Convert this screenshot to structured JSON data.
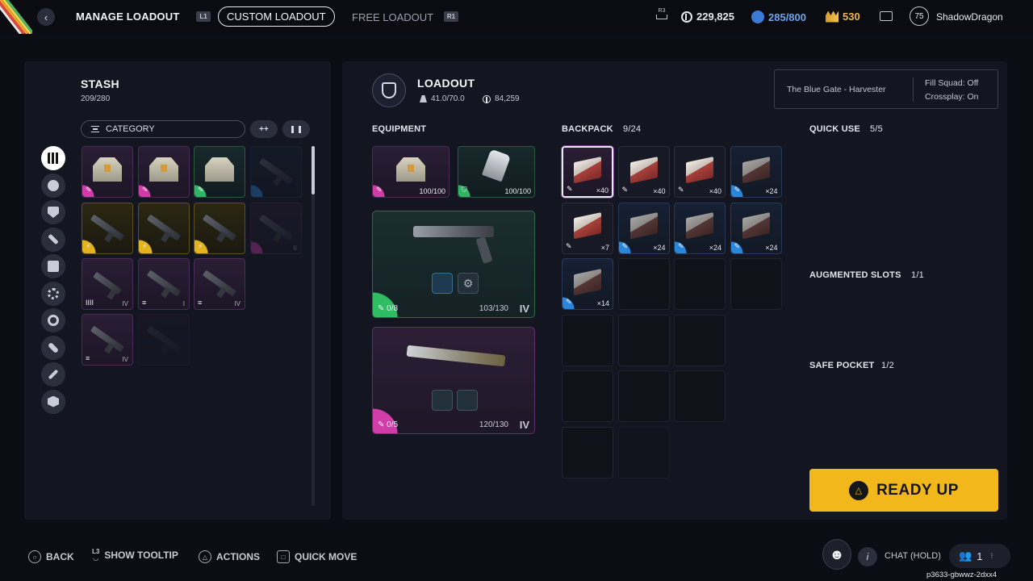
{
  "topbar": {
    "title": "MANAGE LOADOUT",
    "left_shoulder": "L1",
    "right_shoulder": "R1",
    "tabs": [
      {
        "label": "CUSTOM LOADOUT",
        "active": true
      },
      {
        "label": "FREE LOADOUT",
        "active": false
      }
    ],
    "r3_label": "R3",
    "coins": "229,825",
    "blue_currency": "285/800",
    "gold_currency": "530",
    "player_level": "75",
    "player_name": "ShadowDragon"
  },
  "stash": {
    "title": "STASH",
    "capacity": "209/280",
    "category_label": "CATEGORY",
    "expand_glyph": "++",
    "rows": [
      [
        {
          "rarity": "purple",
          "kind": "vest",
          "tag": "",
          "faded": false
        },
        {
          "rarity": "purple",
          "kind": "vest",
          "tag": "",
          "faded": false
        },
        {
          "rarity": "green",
          "kind": "vest",
          "tag": "",
          "faded": false
        },
        {
          "rarity": "blue",
          "kind": "gun",
          "tag": "",
          "faded": true
        }
      ],
      [
        {
          "rarity": "yellow",
          "kind": "gun",
          "tag": "",
          "faded": false
        },
        {
          "rarity": "yellow",
          "kind": "gun",
          "tag": "",
          "faded": false
        },
        {
          "rarity": "yellow",
          "kind": "gun",
          "tag": "",
          "faded": false
        },
        {
          "rarity": "purple",
          "kind": "gun",
          "tag": "II",
          "faded": true
        }
      ],
      [
        {
          "rarity": "purple",
          "kind": "gun",
          "tag": "IV",
          "faded": false
        },
        {
          "rarity": "purple",
          "kind": "gun",
          "tag": "I",
          "faded": false
        },
        {
          "rarity": "purple",
          "kind": "gun",
          "tag": "IV",
          "faded": false
        }
      ],
      [
        {
          "rarity": "purple",
          "kind": "gun",
          "tag": "IV",
          "faded": false
        },
        {
          "rarity": "purple",
          "kind": "gun",
          "tag": "",
          "faded": true
        }
      ]
    ],
    "category_icons": [
      "grid-icon",
      "ammo-icon",
      "shield-icon",
      "gun-icon",
      "book-icon",
      "gear-icon",
      "ring-icon",
      "bandage-icon",
      "wrench-icon",
      "cube-icon"
    ]
  },
  "loadout": {
    "title": "LOADOUT",
    "weight": "41.0/70.0",
    "value": "84,259",
    "map_name": "The Blue Gate - Harvester",
    "fill_squad": "Fill Squad: Off",
    "crossplay": "Crossplay: On",
    "equipment_label": "EQUIPMENT",
    "armor_durability": "100/100",
    "shield_durability": "100/100",
    "weapon1_ammo": "0/8",
    "weapon1_durability": "103/130",
    "weapon1_tier": "IV",
    "weapon2_ammo": "0/5",
    "weapon2_durability": "120/130",
    "weapon2_tier": "IV"
  },
  "backpack": {
    "label": "BACKPACK",
    "count": "9/24",
    "items": [
      {
        "qty": "×40",
        "rarity": "purple",
        "selected": true
      },
      {
        "qty": "×40",
        "rarity": "plain",
        "selected": false
      },
      {
        "qty": "×40",
        "rarity": "plain",
        "selected": false
      },
      {
        "qty": "×24",
        "rarity": "blue",
        "selected": false
      },
      {
        "qty": "×7",
        "rarity": "plain",
        "selected": false
      },
      {
        "qty": "×24",
        "rarity": "blue",
        "selected": false
      },
      {
        "qty": "×24",
        "rarity": "blue",
        "selected": false
      },
      {
        "qty": "×24",
        "rarity": "blue",
        "selected": false
      },
      {
        "qty": "×14",
        "rarity": "blue",
        "selected": false
      }
    ]
  },
  "side": {
    "quick_use_label": "QUICK USE",
    "quick_use_count": "5/5",
    "augmented_label": "AUGMENTED SLOTS",
    "augmented_count": "1/1",
    "safe_pocket_label": "SAFE POCKET",
    "safe_pocket_count": "1/2"
  },
  "ready_button": "READY UP",
  "bottom": {
    "back": "BACK",
    "tooltip_glyph": "L3",
    "tooltip": "SHOW TOOLTIP",
    "actions": "ACTIONS",
    "quick_move": "QUICK MOVE",
    "chat": "CHAT (HOLD)",
    "party_count": "1",
    "session_code": "p3633-gbwwz-2dxx4"
  },
  "colors": {
    "accent": "#f2b81b",
    "rarity_purple": "#d13ba8",
    "rarity_green": "#2fb563",
    "rarity_yellow": "#e3b41e",
    "rarity_blue": "#2a86d9"
  }
}
